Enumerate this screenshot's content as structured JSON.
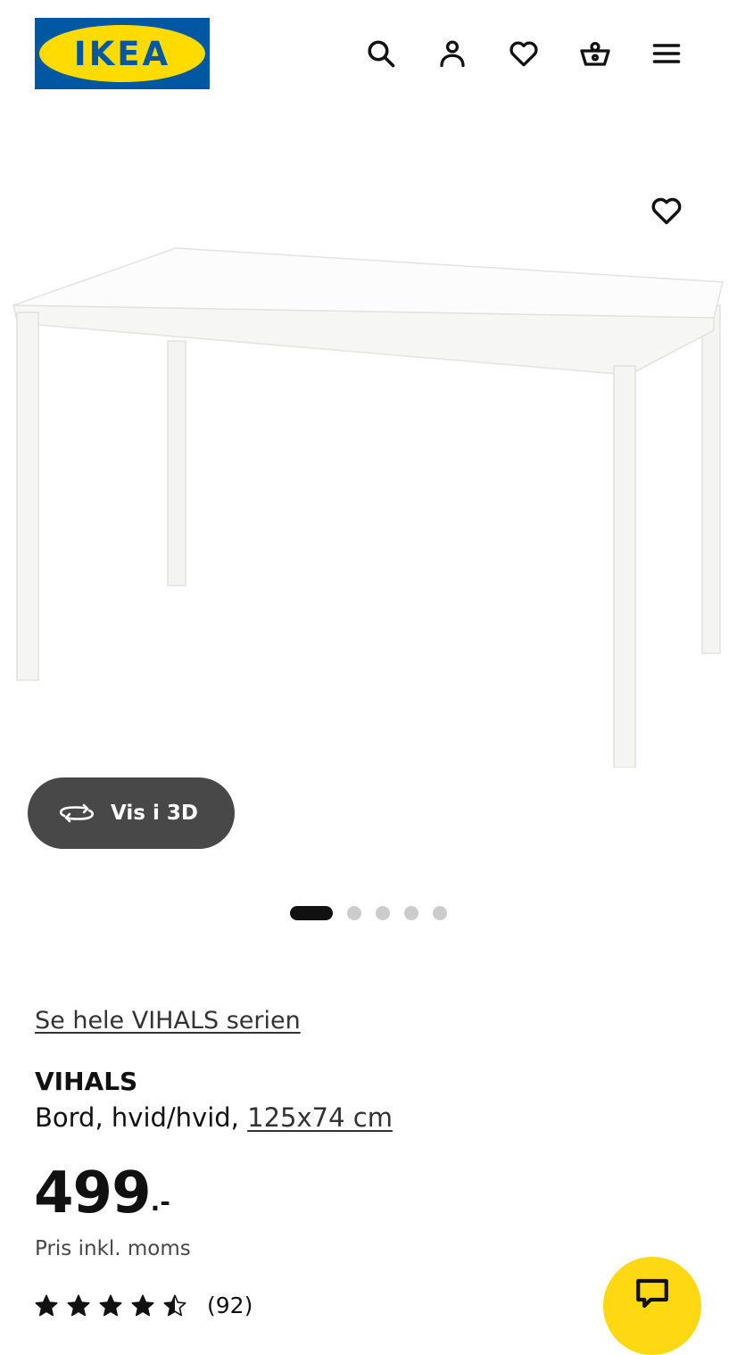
{
  "header": {
    "logo_text": "IKEA",
    "brand_colors": {
      "blue": "#0058a3",
      "yellow": "#ffdb00"
    },
    "icons": [
      "search-icon",
      "account-icon",
      "favourites-icon",
      "cart-icon",
      "menu-icon"
    ]
  },
  "gallery": {
    "image_subject": "white table",
    "favourite_icon": "heart-icon",
    "view_3d_label": "Vis i 3D",
    "view_3d_icon": "rotate-3d-icon",
    "image_count": 5,
    "active_index": 0
  },
  "product": {
    "series_link": "Se hele VIHALS serien",
    "name": "VIHALS",
    "description": "Bord, hvid/hvid,",
    "size_link": "125x74 cm",
    "price_integer": "499",
    "price_decimal": ".-",
    "vat_note": "Pris inkl. moms",
    "rating_stars": 4.5,
    "review_count": "(92)"
  },
  "chat": {
    "icon": "chat-icon",
    "color": "#ffd814"
  }
}
